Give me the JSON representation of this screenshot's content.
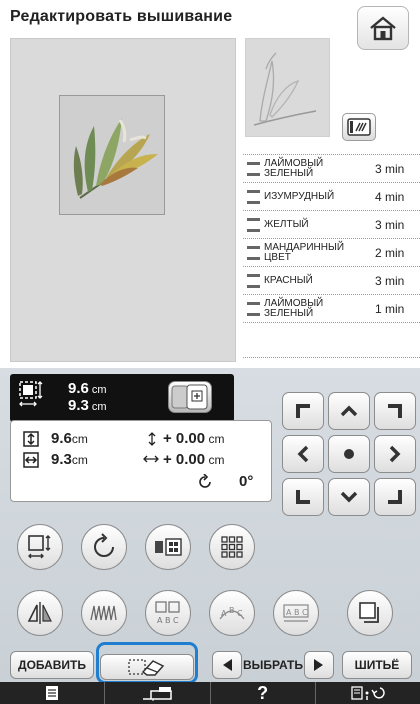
{
  "header": {
    "title": "Редактировать вышивание"
  },
  "colors": {
    "accent": "#1f7ecf",
    "panel": "#cbd2d8",
    "thread_swatch": "#666666"
  },
  "threads": [
    {
      "name": "ЛАЙМОВЫЙ ЗЕЛЕНЫЙ",
      "time": "3 min"
    },
    {
      "name": "ИЗУМРУДНЫЙ",
      "time": "4 min"
    },
    {
      "name": "ЖЕЛТЫЙ",
      "time": "3 min"
    },
    {
      "name": "МАНДАРИННЫЙ ЦВЕТ",
      "time": "2 min"
    },
    {
      "name": "КРАСНЫЙ",
      "time": "3 min"
    },
    {
      "name": "ЛАЙМОВЫЙ ЗЕЛЕНЫЙ",
      "time": "1 min"
    }
  ],
  "size_display": {
    "height": "9.6",
    "width": "9.3",
    "unit": "cm"
  },
  "edit_info": {
    "height": "9.6",
    "width": "9.3",
    "unit": "cm",
    "move_v": "+ 0.00",
    "move_h": "+ 0.00",
    "rotation": "0°"
  },
  "buttons": {
    "add": "ДОБАВИТЬ",
    "select": "ВЫБРАТЬ",
    "sew": "ШИТЬЁ",
    "help": "?"
  },
  "icons": [
    "home-icon",
    "thread-display-icon",
    "resize-icon",
    "rotate-icon",
    "color-change-icon",
    "density-icon",
    "mirror-icon",
    "stitch-density-icon",
    "array-icon",
    "curve-icon",
    "spacing-icon",
    "border-icon",
    "delete-eraser-icon",
    "document-icon",
    "sewing-machine-icon",
    "settings-icon"
  ]
}
